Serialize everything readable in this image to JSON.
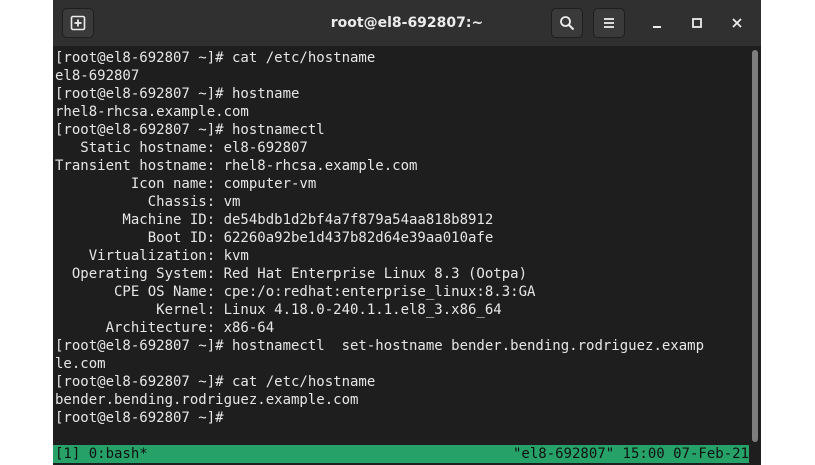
{
  "window": {
    "title": "root@el8-692807:~",
    "buttons": {
      "new_tab": "new-tab-icon",
      "search": "search-icon",
      "menu": "hamburger-menu-icon",
      "minimize": "minimize-icon",
      "maximize": "maximize-icon",
      "close": "close-icon"
    }
  },
  "terminal": {
    "lines": [
      "[root@el8-692807 ~]# cat /etc/hostname",
      "el8-692807",
      "[root@el8-692807 ~]# hostname",
      "rhel8-rhcsa.example.com",
      "[root@el8-692807 ~]# hostnamectl",
      "   Static hostname: el8-692807",
      "Transient hostname: rhel8-rhcsa.example.com",
      "         Icon name: computer-vm",
      "           Chassis: vm",
      "        Machine ID: de54bdb1d2bf4a7f879a54aa818b8912",
      "           Boot ID: 62260a92be1d437b82d64e39aa010afe",
      "    Virtualization: kvm",
      "  Operating System: Red Hat Enterprise Linux 8.3 (Ootpa)",
      "       CPE OS Name: cpe:/o:redhat:enterprise_linux:8.3:GA",
      "            Kernel: Linux 4.18.0-240.1.1.el8_3.x86_64",
      "      Architecture: x86-64",
      "[root@el8-692807 ~]# hostnamectl  set-hostname bender.bending.rodriguez.examp",
      "le.com",
      "[root@el8-692807 ~]# cat /etc/hostname",
      "bender.bending.rodriguez.example.com",
      "[root@el8-692807 ~]#"
    ]
  },
  "statusbar": {
    "left": "[1] 0:bash*",
    "right": "\"el8-692807\" 15:00 07-Feb-21"
  },
  "colors": {
    "titlebar": "#303030",
    "terminal_bg": "#1e1e1e",
    "terminal_fg": "#e6e6e6",
    "statusbar_bg": "#26a269"
  }
}
